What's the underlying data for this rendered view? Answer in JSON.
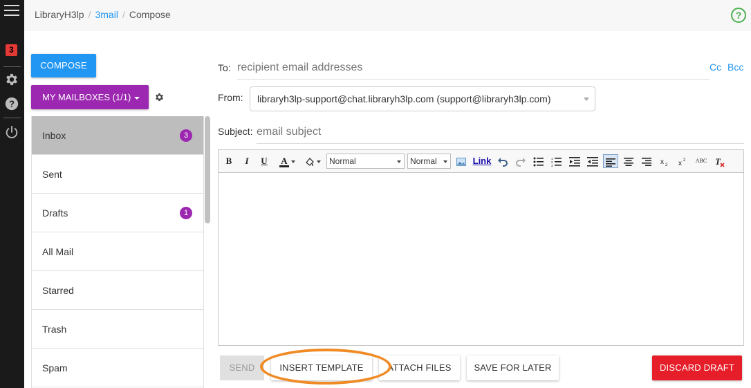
{
  "rail": {
    "notification_count": "3"
  },
  "breadcrumb": [
    "LibraryH3lp",
    "3mail",
    "Compose"
  ],
  "sidebar": {
    "compose_label": "COMPOSE",
    "mailboxes_label": "MY MAILBOXES (1/1)",
    "folders": [
      {
        "name": "Inbox",
        "count": "3",
        "active": true
      },
      {
        "name": "Sent",
        "count": ""
      },
      {
        "name": "Drafts",
        "count": "1"
      },
      {
        "name": "All Mail",
        "count": ""
      },
      {
        "name": "Starred",
        "count": ""
      },
      {
        "name": "Trash",
        "count": ""
      },
      {
        "name": "Spam",
        "count": ""
      }
    ]
  },
  "compose": {
    "to_label": "To:",
    "to_placeholder": "recipient email addresses",
    "cc_label": "Cc",
    "bcc_label": "Bcc",
    "from_label": "From:",
    "from_value": "libraryh3lp-support@chat.libraryh3lp.com (support@libraryh3lp.com)",
    "subject_label": "Subject:",
    "subject_placeholder": "email subject"
  },
  "toolbar": {
    "bold": "B",
    "italic": "I",
    "underline": "U",
    "format_select": "Normal",
    "size_select": "Normal",
    "link": "Link",
    "spellcheck": "ABC"
  },
  "actions": {
    "send": "SEND",
    "insert_template": "INSERT TEMPLATE",
    "attach_files": "ATTACH FILES",
    "save_for_later": "SAVE FOR LATER",
    "discard_draft": "DISCARD DRAFT"
  },
  "colors": {
    "primary": "#2196f3",
    "purple": "#9c27b0",
    "danger": "#e61e2a",
    "highlight": "#f08a24",
    "help_green": "#4caf50"
  },
  "icons": [
    "menu-icon",
    "gear-icon",
    "help-icon",
    "power-icon",
    "settings-gear-icon",
    "image-icon",
    "undo-icon",
    "redo-icon"
  ]
}
